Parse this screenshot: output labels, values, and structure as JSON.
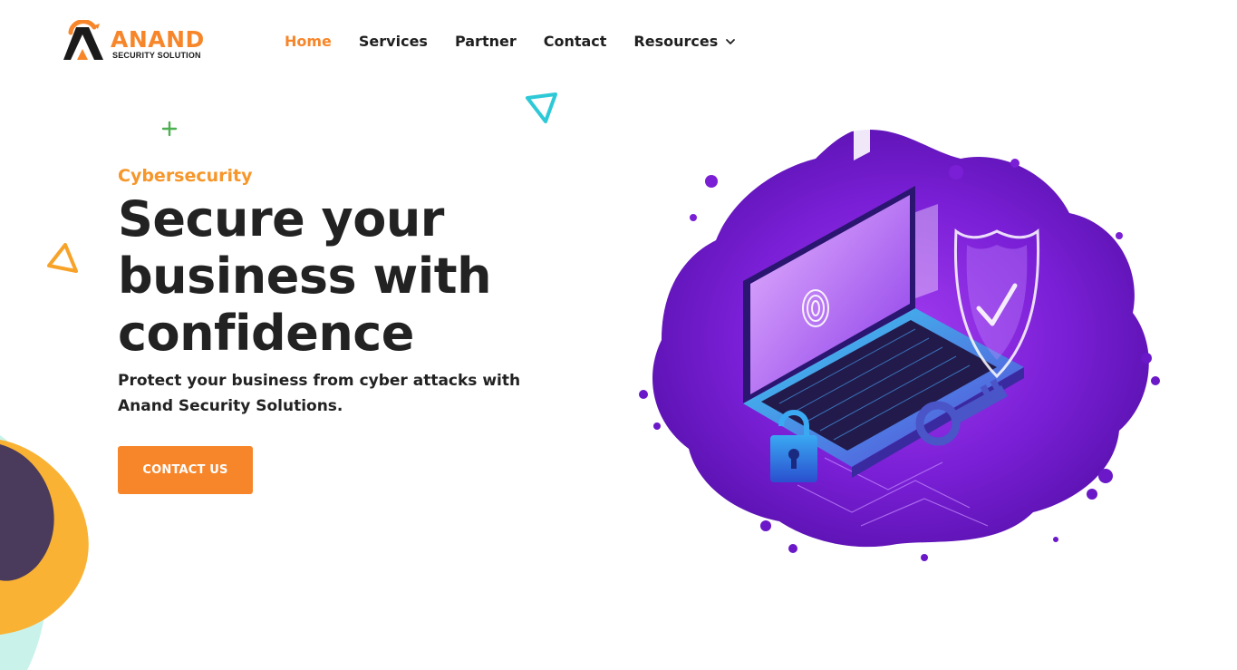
{
  "brand": {
    "name": "ANAND",
    "tagline": "SECURITY SOLUTION"
  },
  "nav": {
    "items": [
      {
        "label": "Home",
        "active": true
      },
      {
        "label": "Services",
        "active": false
      },
      {
        "label": "Partner",
        "active": false
      },
      {
        "label": "Contact",
        "active": false
      },
      {
        "label": "Resources",
        "active": false,
        "has_dropdown": true,
        "icon": "chevron-down-icon"
      }
    ]
  },
  "hero": {
    "eyebrow": "Cybersecurity",
    "headline": "Secure your business with confidence",
    "subtext": "Protect your business from cyber attacks with Anand Security Solutions.",
    "cta_label": "CONTACT US"
  },
  "illustration": {
    "subject": "laptop-fingerprint-shield-lock-key-illustration"
  },
  "colors": {
    "accent": "#f7862a",
    "eyebrow": "#f7962a",
    "text": "#222222",
    "purple": "#7a1fd6",
    "cyan": "#2ec9d6",
    "green": "#4caf50"
  }
}
